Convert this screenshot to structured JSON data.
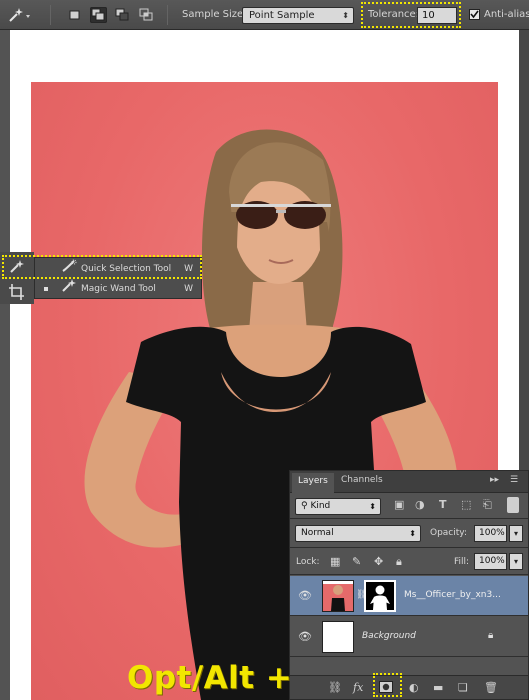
{
  "options_bar": {
    "sample_size_label": "Sample Size:",
    "sample_size_value": "Point Sample",
    "tolerance_label": "Tolerance:",
    "tolerance_value": "10",
    "anti_alias_label": "Anti-alias",
    "anti_alias_checked": true,
    "highlight_color": "#f2e600"
  },
  "tool_flyout": {
    "items": [
      {
        "label": "Quick Selection Tool",
        "shortcut": "W",
        "icon": "quick-selection-icon",
        "selected": false
      },
      {
        "label": "Magic Wand Tool",
        "shortcut": "W",
        "icon": "magic-wand-icon",
        "selected": true
      }
    ]
  },
  "layers_panel": {
    "tabs": [
      "Layers",
      "Channels"
    ],
    "filter_kind": "Kind",
    "blend_mode": "Normal",
    "opacity_label": "Opacity:",
    "opacity_value": "100%",
    "lock_label": "Lock:",
    "fill_label": "Fill:",
    "fill_value": "100%",
    "layers": [
      {
        "name": "Ms__Officer_by_xn3...",
        "selected": true,
        "has_mask": true,
        "locked": false
      },
      {
        "name": "Background",
        "selected": false,
        "has_mask": false,
        "locked": true
      }
    ],
    "selection_color": "#6b84a7"
  },
  "canvas": {
    "background_color": "#e86b6b"
  },
  "overlay_text": "Opt/Alt +"
}
